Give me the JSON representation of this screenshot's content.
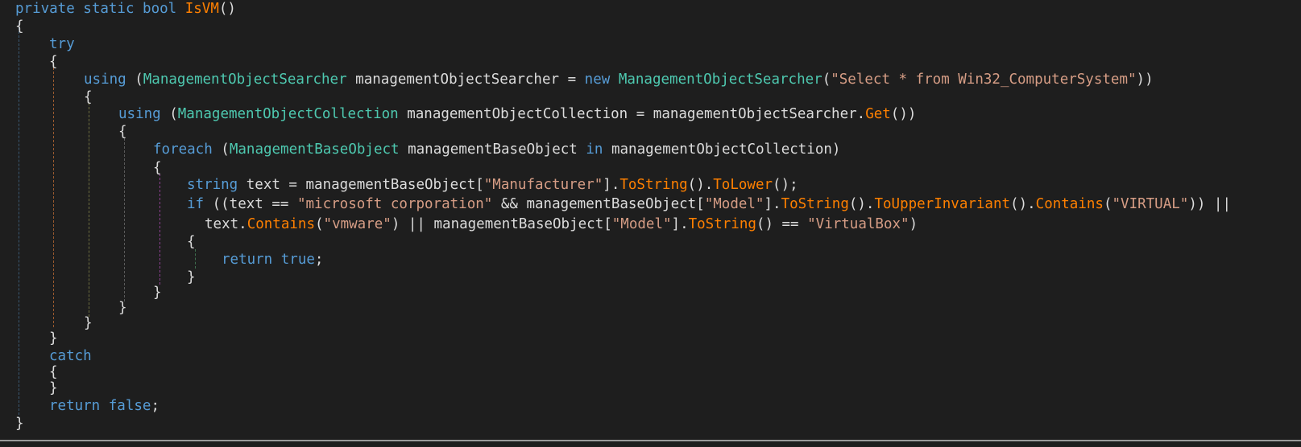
{
  "editor": {
    "lines": [
      [
        {
          "t": "private static bool ",
          "c": "keyword"
        },
        {
          "t": "IsVM",
          "c": "method"
        },
        {
          "t": "()",
          "c": "plain"
        }
      ],
      [
        {
          "t": "{",
          "c": "plain"
        }
      ],
      [
        {
          "t": "try",
          "c": "keyword"
        }
      ],
      [
        {
          "t": "{",
          "c": "plain"
        }
      ],
      [
        {
          "t": "using",
          "c": "keyword"
        },
        {
          "t": " (",
          "c": "plain"
        },
        {
          "t": "ManagementObjectSearcher",
          "c": "type"
        },
        {
          "t": " managementObjectSearcher = ",
          "c": "plain"
        },
        {
          "t": "new",
          "c": "keyword"
        },
        {
          "t": " ",
          "c": "plain"
        },
        {
          "t": "ManagementObjectSearcher",
          "c": "type"
        },
        {
          "t": "(",
          "c": "plain"
        },
        {
          "t": "\"Select * from Win32_ComputerSystem\"",
          "c": "string"
        },
        {
          "t": "))",
          "c": "plain"
        }
      ],
      [
        {
          "t": "{",
          "c": "plain"
        }
      ],
      [
        {
          "t": "using",
          "c": "keyword"
        },
        {
          "t": " (",
          "c": "plain"
        },
        {
          "t": "ManagementObjectCollection",
          "c": "type"
        },
        {
          "t": " managementObjectCollection = managementObjectSearcher.",
          "c": "plain"
        },
        {
          "t": "Get",
          "c": "method"
        },
        {
          "t": "())",
          "c": "plain"
        }
      ],
      [
        {
          "t": "{",
          "c": "plain"
        }
      ],
      [
        {
          "t": "foreach",
          "c": "keyword"
        },
        {
          "t": " (",
          "c": "plain"
        },
        {
          "t": "ManagementBaseObject",
          "c": "type"
        },
        {
          "t": " managementBaseObject ",
          "c": "plain"
        },
        {
          "t": "in",
          "c": "keyword"
        },
        {
          "t": " managementObjectCollection)",
          "c": "plain"
        }
      ],
      [
        {
          "t": "{",
          "c": "plain"
        }
      ],
      [
        {
          "t": "string",
          "c": "keyword"
        },
        {
          "t": " text = managementBaseObject[",
          "c": "plain"
        },
        {
          "t": "\"Manufacturer\"",
          "c": "string"
        },
        {
          "t": "].",
          "c": "plain"
        },
        {
          "t": "ToString",
          "c": "method"
        },
        {
          "t": "().",
          "c": "plain"
        },
        {
          "t": "ToLower",
          "c": "method"
        },
        {
          "t": "();",
          "c": "plain"
        }
      ],
      [
        {
          "t": "if",
          "c": "keyword"
        },
        {
          "t": " ((text == ",
          "c": "plain"
        },
        {
          "t": "\"microsoft corporation\"",
          "c": "string"
        },
        {
          "t": " && managementBaseObject[",
          "c": "plain"
        },
        {
          "t": "\"Model\"",
          "c": "string"
        },
        {
          "t": "].",
          "c": "plain"
        },
        {
          "t": "ToString",
          "c": "method"
        },
        {
          "t": "().",
          "c": "plain"
        },
        {
          "t": "ToUpperInvariant",
          "c": "method"
        },
        {
          "t": "().",
          "c": "plain"
        },
        {
          "t": "Contains",
          "c": "method"
        },
        {
          "t": "(",
          "c": "plain"
        },
        {
          "t": "\"VIRTUAL\"",
          "c": "string"
        },
        {
          "t": ")) ||",
          "c": "plain"
        }
      ],
      [
        {
          "t": "text.",
          "c": "plain"
        },
        {
          "t": "Contains",
          "c": "method"
        },
        {
          "t": "(",
          "c": "plain"
        },
        {
          "t": "\"vmware\"",
          "c": "string"
        },
        {
          "t": ") || managementBaseObject[",
          "c": "plain"
        },
        {
          "t": "\"Model\"",
          "c": "string"
        },
        {
          "t": "].",
          "c": "plain"
        },
        {
          "t": "ToString",
          "c": "method"
        },
        {
          "t": "() == ",
          "c": "plain"
        },
        {
          "t": "\"VirtualBox\"",
          "c": "string"
        },
        {
          "t": ")",
          "c": "plain"
        }
      ],
      [
        {
          "t": "{",
          "c": "plain"
        }
      ],
      [
        {
          "t": "return",
          "c": "keyword"
        },
        {
          "t": " ",
          "c": "plain"
        },
        {
          "t": "true",
          "c": "keyword"
        },
        {
          "t": ";",
          "c": "plain"
        }
      ],
      [
        {
          "t": "}",
          "c": "plain"
        }
      ],
      [
        {
          "t": "}",
          "c": "plain"
        }
      ],
      [
        {
          "t": "}",
          "c": "plain"
        }
      ],
      [
        {
          "t": "}",
          "c": "plain"
        }
      ],
      [
        {
          "t": "}",
          "c": "plain"
        }
      ],
      [
        {
          "t": "catch",
          "c": "keyword"
        }
      ],
      [
        {
          "t": "{",
          "c": "plain"
        }
      ],
      [
        {
          "t": "}",
          "c": "plain"
        }
      ],
      [
        {
          "t": "return",
          "c": "keyword"
        },
        {
          "t": " ",
          "c": "plain"
        },
        {
          "t": "false",
          "c": "keyword"
        },
        {
          "t": ";",
          "c": "plain"
        }
      ],
      [
        {
          "t": "}",
          "c": "plain"
        }
      ]
    ]
  },
  "colors": {
    "background": "#1e1e1e",
    "keyword": "#569cd6",
    "type": "#4ec9b0",
    "method": "#ff8000",
    "string": "#d69d85",
    "plain": "#dcdcdc"
  }
}
